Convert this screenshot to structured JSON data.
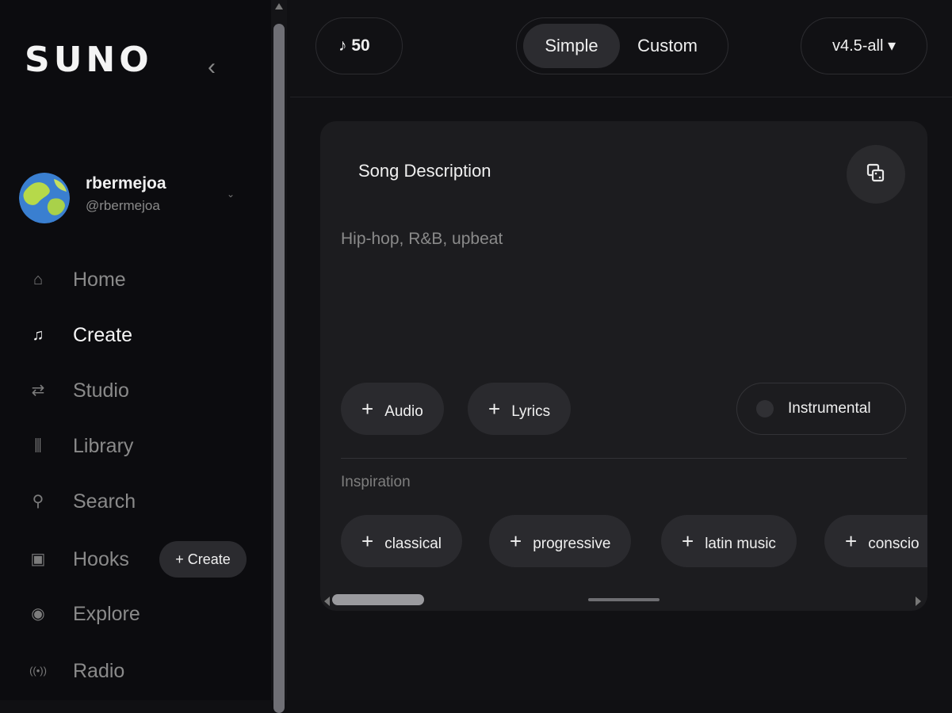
{
  "sidebar": {
    "logo": "SUNO",
    "collapse_icon": "‹",
    "user": {
      "name": "rbermejoa",
      "handle": "@rbermejoa"
    },
    "nav": [
      {
        "label": "Home",
        "icon": "home-icon",
        "glyph": "⌂"
      },
      {
        "label": "Create",
        "icon": "create-music-icon",
        "glyph": "♫"
      },
      {
        "label": "Studio",
        "icon": "studio-icon",
        "glyph": "⇄"
      },
      {
        "label": "Library",
        "icon": "library-icon",
        "glyph": "⫼"
      },
      {
        "label": "Search",
        "icon": "search-icon",
        "glyph": "⚲"
      },
      {
        "label": "Hooks",
        "icon": "hooks-icon",
        "glyph": "▣"
      },
      {
        "label": "Explore",
        "icon": "explore-icon",
        "glyph": "◉"
      },
      {
        "label": "Radio",
        "icon": "radio-icon",
        "glyph": "((•))"
      }
    ],
    "active_nav": "Create",
    "hooks_create_label": "+ Create"
  },
  "topbar": {
    "credits": "♪ 50",
    "modes": [
      "Simple",
      "Custom"
    ],
    "active_mode": "Simple",
    "version": "v4.5-all ▾"
  },
  "card": {
    "song_description_label": "Song Description",
    "placeholder": "Hip-hop, R&B, upbeat",
    "add_buttons": [
      "Audio",
      "Lyrics"
    ],
    "instrumental_label": "Instrumental",
    "inspiration_label": "Inspiration",
    "inspiration_tags": [
      "classical",
      "progressive",
      "latin music",
      "conscio"
    ]
  },
  "colors": {
    "background": "#101013",
    "sidebar": "#0c0c0f",
    "card": "#1c1c1f",
    "pill": "#2a2a2e",
    "text": "#f0f0f0",
    "muted": "#8a8a8a"
  }
}
